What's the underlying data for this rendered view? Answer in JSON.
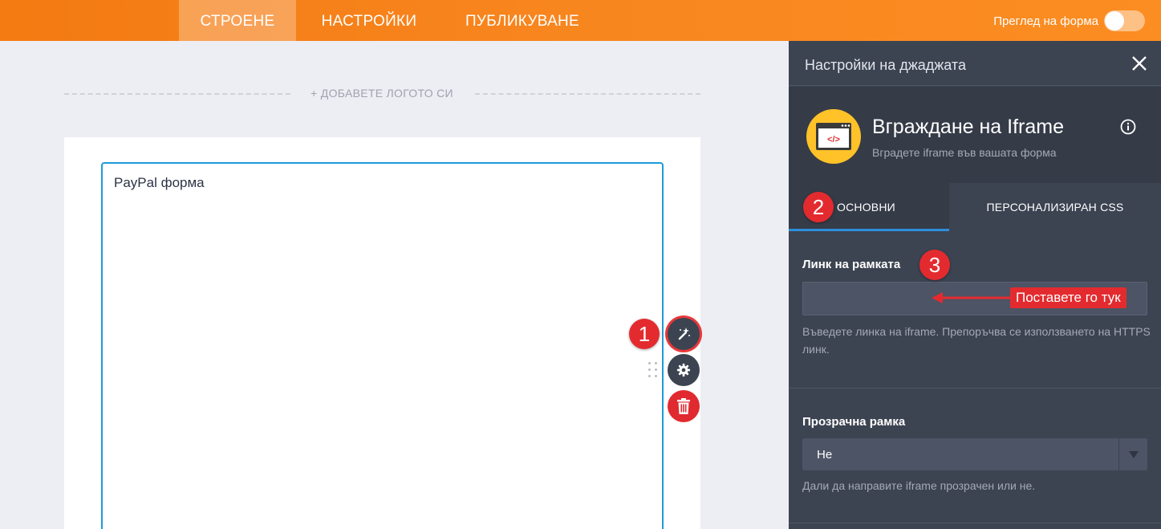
{
  "topbar": {
    "tabs": [
      {
        "label": "СТРОЕНЕ",
        "active": true
      },
      {
        "label": "НАСТРОЙКИ",
        "active": false
      },
      {
        "label": "ПУБЛИКУВАНЕ",
        "active": false
      }
    ],
    "preview_label": "Преглед на форма",
    "preview_on": false
  },
  "canvas": {
    "add_logo": "+ ДОБАВЕТЕ ЛОГОТО СИ",
    "widget_title": "PayPal форма"
  },
  "panel": {
    "title": "Настройки на джаджата",
    "widget": {
      "name": "Вграждане на Iframe",
      "description": "Вградете iframe във вашата форма"
    },
    "tabs": [
      {
        "label": "ОСНОВНИ",
        "active": true
      },
      {
        "label": "ПЕРСОНАЛИЗИРАН CSS",
        "active": false
      }
    ],
    "link_field": {
      "label": "Линк на рамката",
      "value": "",
      "hint": "Въведете линка на iframe. Препоръчва се използването на HTTPS линк."
    },
    "transparent_field": {
      "label": "Прозрачна рамка",
      "value": "Не",
      "hint": "Дали да направите iframe прозрачен или не."
    }
  },
  "annotations": {
    "steps": [
      "1",
      "2",
      "3"
    ],
    "callout": "Поставете го тук"
  },
  "colors": {
    "topbar": "#f8861f",
    "panel_bg": "#3c4351",
    "accent_blue": "#1e9bd8",
    "step_red": "#e32b2f",
    "widget_icon_yellow": "#ffc229"
  }
}
